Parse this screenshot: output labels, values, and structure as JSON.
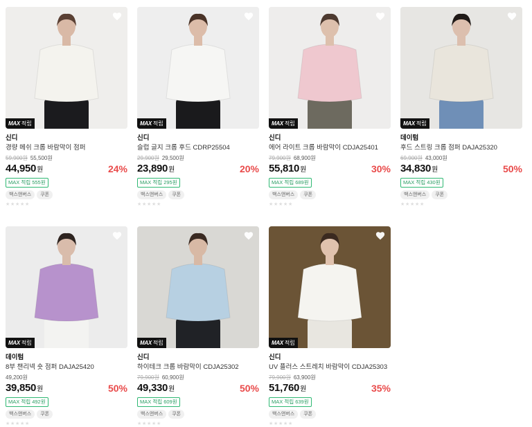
{
  "products": [
    {
      "brand": "신디",
      "name": "경량 메쉬 크롭 바람막이 점퍼",
      "orig": "59,900원",
      "sale_orig": "55,500원",
      "price": "44,950",
      "won": "원",
      "pct": "24%",
      "points": "MAX 적립 555원",
      "badges": [
        "백스앤버스",
        "쿠폰"
      ],
      "tag": "적립",
      "tag_mark": "MAX",
      "heart": "heart-icon",
      "img": {
        "bg": "#efeeec",
        "top": "#f4f3ee",
        "bottom": "#1b1b1e",
        "skin": "#d9b9a6",
        "hair": "#5a4034"
      }
    },
    {
      "brand": "신디",
      "name": "슬럽 글지 크롭 후드 CDRP25504",
      "orig": "29,900원",
      "sale_orig": "29,500원",
      "price": "23,890",
      "won": "원",
      "pct": "20%",
      "points": "MAX 적립 295원",
      "badges": [
        "백스앤버스",
        "쿠폰"
      ],
      "tag": "적립",
      "tag_mark": "MAX",
      "heart": "heart-icon",
      "img": {
        "bg": "#eeeeee",
        "top": "#f6f6f4",
        "bottom": "#1a1a1c",
        "skin": "#dcbca9",
        "hair": "#4a3328"
      }
    },
    {
      "brand": "신디",
      "name": "에어 라이트 크롭 바람막이 CDJA25401",
      "orig": "79,900원",
      "sale_orig": "68,900원",
      "price": "55,810",
      "won": "원",
      "pct": "30%",
      "points": "MAX 적립 689원",
      "badges": [
        "백스앤버스",
        "쿠폰"
      ],
      "tag": "적립",
      "tag_mark": "MAX",
      "heart": "heart-icon",
      "img": {
        "bg": "#eeedec",
        "top": "#efc8cf",
        "bottom": "#6d6a5f",
        "skin": "#ddc0ad",
        "hair": "#4d3a30"
      }
    },
    {
      "brand": "데이텀",
      "name": "후드 스트링 크롭 점퍼 DAJA25320",
      "orig": "69,900원",
      "sale_orig": "43,000원",
      "price": "34,830",
      "won": "원",
      "pct": "50%",
      "points": "MAX 적립 430원",
      "badges": [
        "백스앤버스",
        "쿠폰"
      ],
      "tag": "적립",
      "tag_mark": "MAX",
      "heart": "heart-icon",
      "img": {
        "bg": "#e7e6e3",
        "top": "#e9e5dc",
        "bottom": "#6f8fb7",
        "skin": "#dcbfae",
        "hair": "#201a18"
      }
    },
    {
      "brand": "데이텀",
      "name": "8부 챈리넥 숏 점퍼 DAJA25420",
      "orig": "",
      "sale_orig": "49,200원",
      "price": "39,850",
      "won": "원",
      "pct": "50%",
      "points": "MAX 적립 492원",
      "badges": [
        "백스앤버스",
        "쿠폰"
      ],
      "tag": "적립",
      "tag_mark": "MAX",
      "heart": "heart-icon",
      "img": {
        "bg": "#ececec",
        "top": "#b792cc",
        "bottom": "#f3f3f1",
        "skin": "#d9bcab",
        "hair": "#2e2420"
      }
    },
    {
      "brand": "신디",
      "name": "하이테크 크롭 바람막이 CDJA25302",
      "orig": "79,900원",
      "sale_orig": "60,900원",
      "price": "49,330",
      "won": "원",
      "pct": "50%",
      "points": "MAX 적립 609원",
      "badges": [
        "백스앤버스",
        "쿠폰"
      ],
      "tag": "적립",
      "tag_mark": "MAX",
      "heart": "heart-icon",
      "img": {
        "bg": "#d9d8d4",
        "top": "#b7d0e2",
        "bottom": "#202226",
        "skin": "#d8b9a5",
        "hair": "#3a2a22"
      }
    },
    {
      "brand": "신디",
      "name": "UV 플러스 스트레치 바람막이 CDJA25303",
      "orig": "79,900원",
      "sale_orig": "63,900원",
      "price": "51,760",
      "won": "원",
      "pct": "35%",
      "points": "MAX 적립 639원",
      "badges": [
        "백스앤버스",
        "쿠폰"
      ],
      "tag": "적립",
      "tag_mark": "MAX",
      "heart": "heart-icon",
      "img": {
        "bg": "#6b5436",
        "top": "#f5f4f0",
        "bottom": "#e8e6e0",
        "skin": "#e0c2ae",
        "hair": "#3b2a20"
      }
    }
  ],
  "colors": {
    "discount": "#e94a4a",
    "points": "#2eb872",
    "strike": "#aaaaaa"
  }
}
